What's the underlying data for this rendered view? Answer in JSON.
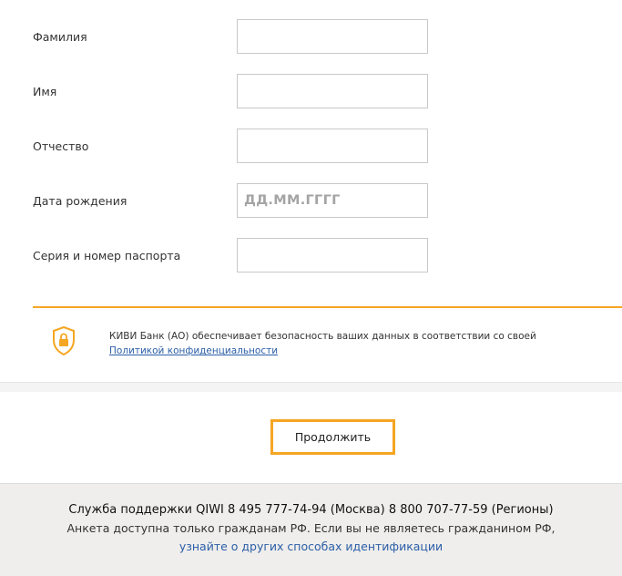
{
  "form": {
    "fields": [
      {
        "label": "Фамилия",
        "value": "",
        "placeholder": ""
      },
      {
        "label": "Имя",
        "value": "",
        "placeholder": ""
      },
      {
        "label": "Отчество",
        "value": "",
        "placeholder": ""
      },
      {
        "label": "Дата рождения",
        "value": "",
        "placeholder": "ДД.ММ.ГГГГ"
      },
      {
        "label": "Серия и номер паспорта",
        "value": "",
        "placeholder": ""
      }
    ]
  },
  "security": {
    "icon": "shield-lock-icon",
    "text": "КИВИ Банк (АО) обеспечивает безопасность ваших данных в соответствии со своей",
    "link": "Политикой конфиденциальности"
  },
  "actions": {
    "continue_label": "Продолжить"
  },
  "footer": {
    "support": "Служба поддержки QIWI 8 495 777-74-94 (Москва) 8 800 707-77-59 (Регионы)",
    "notice": "Анкета доступна только гражданам РФ. Если вы не являетесь гражданином РФ,",
    "link": "узнайте о других способах идентификации"
  },
  "colors": {
    "accent": "#f5a623",
    "link": "#2b5ea7",
    "footer_bg": "#efeeec"
  }
}
